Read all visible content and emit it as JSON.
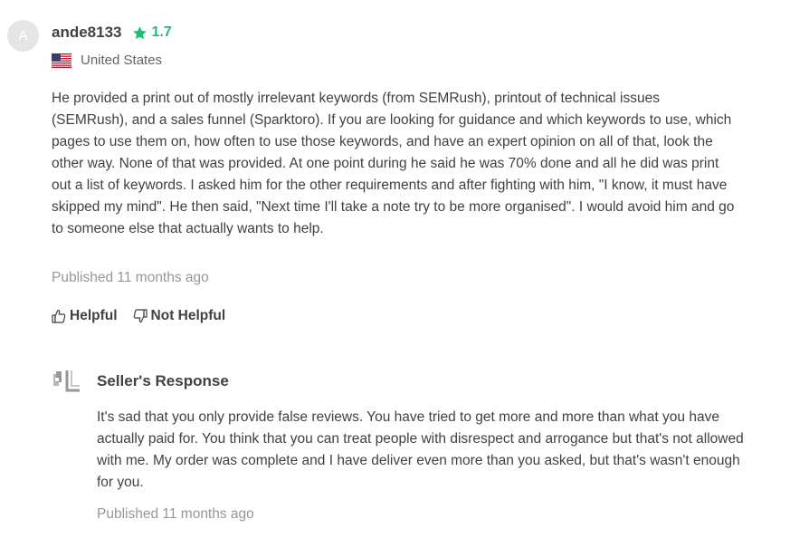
{
  "review": {
    "avatar_initial": "A",
    "username": "ande8133",
    "rating": "1.7",
    "country": "United States",
    "text": "He provided a print out of mostly irrelevant keywords (from SEMRush), printout of technical issues (SEMRush), and a sales funnel (Sparktoro). If you are looking for guidance and which keywords to use, which pages to use them on, how often to use those keywords, and have an expert opinion on all of that, look the other way. None of that was provided. At one point during he said he was 70% done and all he did was print out a list of keywords. I asked him for the other requirements and after fighting with him, \"I know, it must have skipped my mind\". He then said, \"Next time I'll take a note try to be more organised\". I would avoid him and go to someone else that actually wants to help.",
    "published": "Published 11 months ago"
  },
  "actions": {
    "helpful_label": "Helpful",
    "not_helpful_label": "Not Helpful"
  },
  "seller_response": {
    "title": "Seller's Response",
    "text": "It's sad that you only provide false reviews. You have tried to get more and more than what you have actually paid for. You think that you can treat people with disrespect and arrogance but that's not allowed with me. My order was complete and I have deliver even more than you asked, but that's wasn't enough for you.",
    "published": "Published 11 months ago"
  },
  "colors": {
    "rating_green": "#1dbf73",
    "text_dark": "#404145",
    "text_muted": "#95979d"
  },
  "icons": [
    "star-icon",
    "us-flag-icon",
    "thumbs-up-icon",
    "thumbs-down-icon",
    "seller-logo-icon"
  ]
}
